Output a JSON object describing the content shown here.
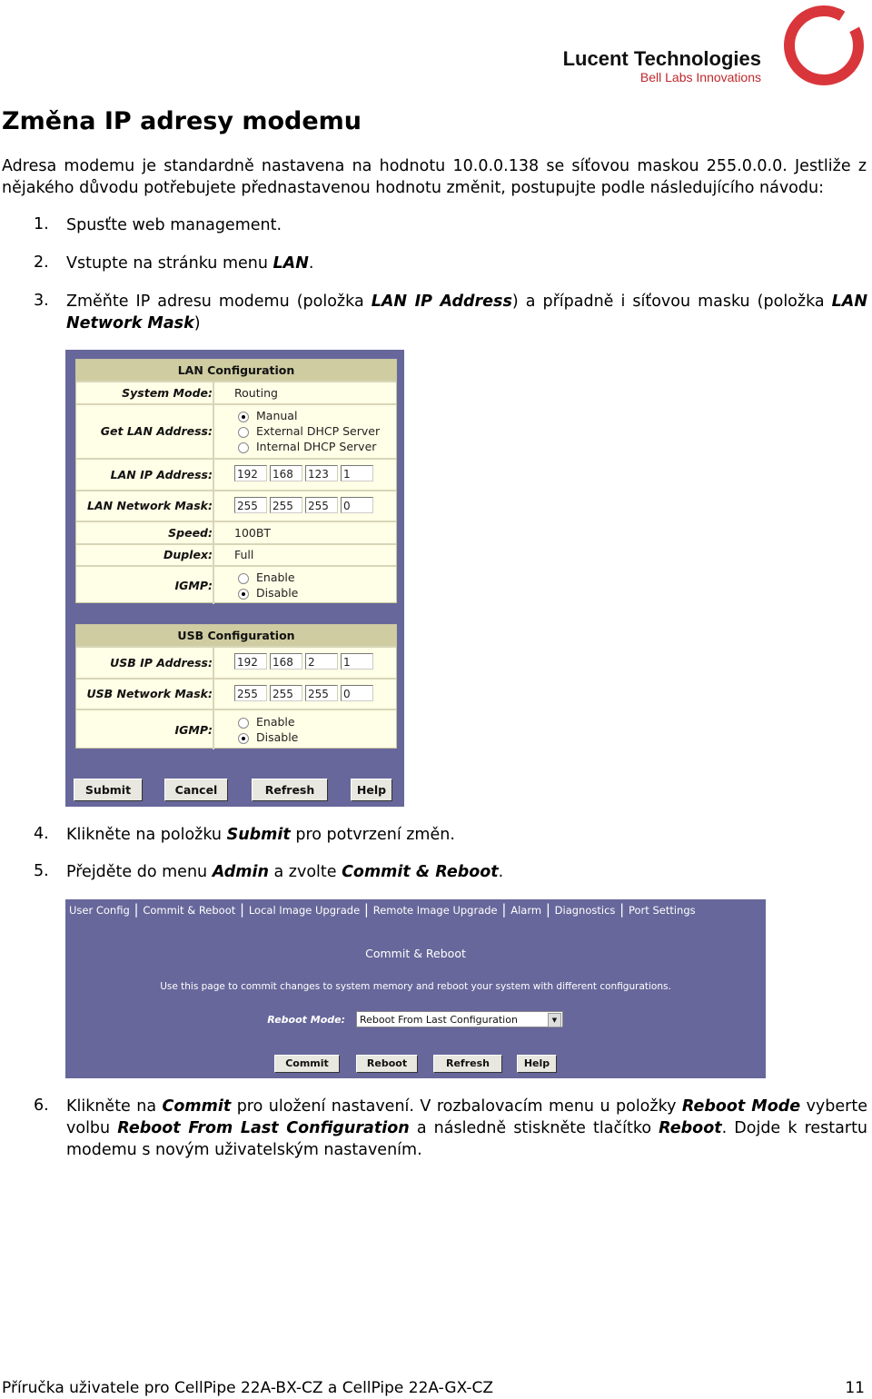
{
  "logo": {
    "title": "Lucent Technologies",
    "subtitle": "Bell Labs Innovations",
    "color": "#c0282d"
  },
  "title": "Změna IP adresy modemu",
  "intro": "Adresa modemu je standardně nastavena na hodnotu 10.0.0.138 se síťovou maskou 255.0.0.0. Jestliže z nějakého důvodu potřebujete přednastavenou hodnotu změnit, postupujte podle následujícího návodu:",
  "steps": [
    {
      "n": "1.",
      "parts": [
        "Spusťte web management."
      ]
    },
    {
      "n": "2.",
      "parts": [
        "Vstupte na stránku menu ",
        "LAN",
        "."
      ]
    },
    {
      "n": "3.",
      "parts": [
        "Změňte IP adresu modemu (položka ",
        "LAN IP Address",
        ") a případně i síťovou masku (položka ",
        "LAN Network Mask",
        ")"
      ]
    },
    {
      "n": "4.",
      "parts": [
        "Klikněte na položku ",
        "Submit",
        " pro potvrzení změn."
      ]
    },
    {
      "n": "5.",
      "parts": [
        "Přejděte do menu ",
        "Admin",
        " a zvolte ",
        "Commit & Reboot",
        "."
      ]
    },
    {
      "n": "6.",
      "parts": [
        "Klikněte na ",
        "Commit",
        " pro uložení nastavení. V rozbalovacím menu u položky ",
        "Reboot Mode",
        " vyberte volbu ",
        "Reboot From Last Configuration",
        " a následně stiskněte tlačítko ",
        "Reboot",
        ". Dojde k restartu modemu s novým uživatelským nastavením."
      ]
    }
  ],
  "lan": {
    "header": "LAN Configuration",
    "system_mode_label": "System Mode:",
    "system_mode": "Routing",
    "get_lan_label": "Get LAN Address:",
    "get_lan_options": [
      "Manual",
      "External DHCP Server",
      "Internal DHCP Server"
    ],
    "get_lan_selected": "Manual",
    "ip_label": "LAN IP Address:",
    "ip": [
      "192",
      "168",
      "123",
      "1"
    ],
    "mask_label": "LAN Network Mask:",
    "mask": [
      "255",
      "255",
      "255",
      "0"
    ],
    "speed_label": "Speed:",
    "speed": "100BT",
    "duplex_label": "Duplex:",
    "duplex": "Full",
    "igmp_label": "IGMP:",
    "igmp_options": [
      "Enable",
      "Disable"
    ],
    "igmp_selected": "Disable"
  },
  "usb": {
    "header": "USB Configuration",
    "ip_label": "USB IP Address:",
    "ip": [
      "192",
      "168",
      "2",
      "1"
    ],
    "mask_label": "USB Network Mask:",
    "mask": [
      "255",
      "255",
      "255",
      "0"
    ],
    "igmp_label": "IGMP:",
    "igmp_options": [
      "Enable",
      "Disable"
    ],
    "igmp_selected": "Disable"
  },
  "lan_buttons": [
    "Submit",
    "Cancel",
    "Refresh",
    "Help"
  ],
  "admin": {
    "tabs": [
      "User Config",
      "Commit & Reboot",
      "Local Image Upgrade",
      "Remote Image Upgrade",
      "Alarm",
      "Diagnostics",
      "Port Settings"
    ],
    "heading": "Commit & Reboot",
    "description": "Use this page to commit changes to system memory and reboot your system with different configurations.",
    "reboot_mode_label": "Reboot Mode:",
    "reboot_mode": "Reboot From Last Configuration",
    "buttons": [
      "Commit",
      "Reboot",
      "Refresh",
      "Help"
    ],
    "bg": "#67679b"
  },
  "footer": {
    "text": "Příručka uživatele pro CellPipe 22A-BX-CZ a CellPipe 22A-GX-CZ",
    "page": "11"
  }
}
